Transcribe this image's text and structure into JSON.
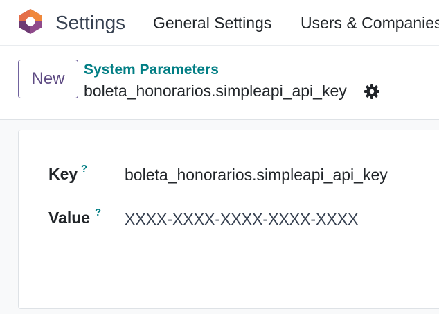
{
  "navbar": {
    "logo_icon": "odoo-app-logo-icon",
    "app_title": "Settings",
    "menu": [
      {
        "label": "General Settings"
      },
      {
        "label": "Users & Companies"
      }
    ]
  },
  "control_panel": {
    "new_label": "New",
    "breadcrumb": "System Parameters",
    "record_name": "boleta_honorarios.simpleapi_api_key",
    "gear_icon": "gear-icon"
  },
  "form": {
    "fields": [
      {
        "label": "Key",
        "help": "?",
        "value": "boleta_honorarios.simpleapi_api_key"
      },
      {
        "label": "Value",
        "help": "?",
        "value": "XXXX-XXXX-XXXX-XXXX-XXXX"
      }
    ]
  },
  "colors": {
    "brand_teal": "#017e84",
    "primary_purple": "#71639e",
    "logo_orange": "#f0883a",
    "logo_purple": "#8f4a8b"
  }
}
